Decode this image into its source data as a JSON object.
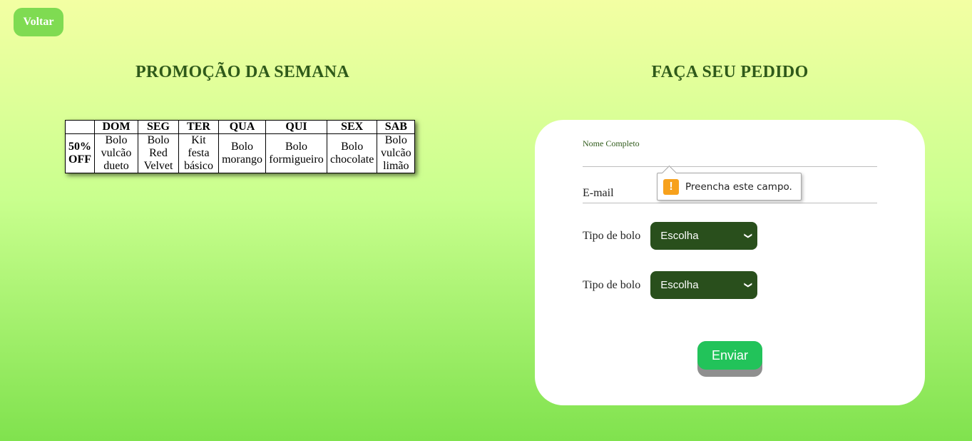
{
  "nav": {
    "back_label": "Voltar"
  },
  "promo": {
    "title": "PROMOÇÃO DA SEMANA",
    "headers": [
      "",
      "DOM",
      "SEG",
      "TER",
      "QUA",
      "QUI",
      "SEX",
      "SAB"
    ],
    "row_label": "50% OFF",
    "cells": [
      "Bolo vulcão dueto",
      "Bolo Red Velvet",
      "Kit festa básico",
      "Bolo morango",
      "Bolo formigueiro",
      "Bolo chocolate",
      "Bolo vulcão limão"
    ]
  },
  "order": {
    "title": "FAÇA SEU PEDIDO",
    "name_label": "Nome Completo",
    "email_label": "E-mail",
    "validation_message": "Preencha este campo.",
    "cake_type_label_1": "Tipo de bolo",
    "cake_type_select_1": "Escolha",
    "cake_type_label_2": "Tipo de bolo",
    "cake_type_select_2": "Escolha",
    "submit_label": "Enviar"
  },
  "colors": {
    "accent_green": "#22c35a",
    "select_bg": "#294f1c",
    "heading": "#2f5a1a",
    "warning": "#f7a11c"
  },
  "icons": {
    "validation": "warning-icon",
    "select": "chevron-down-icon"
  }
}
